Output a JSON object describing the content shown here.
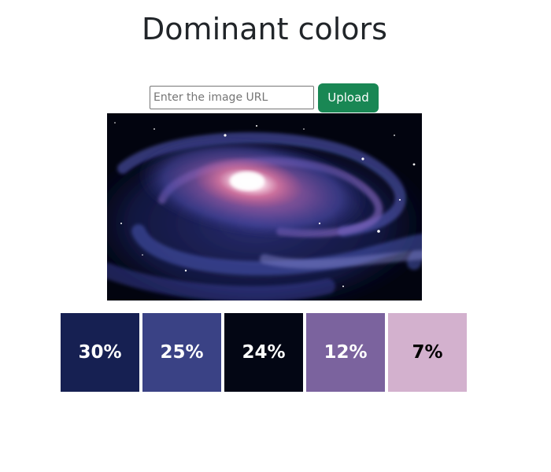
{
  "page": {
    "title": "Dominant colors"
  },
  "form": {
    "url_placeholder": "Enter the image URL",
    "url_value": "",
    "upload_label": "Upload",
    "upload_color": "#198754"
  },
  "image": {
    "subject": "spiral galaxy"
  },
  "swatches": [
    {
      "label": "30%",
      "color": "#162052",
      "text_color": "#ffffff"
    },
    {
      "label": "25%",
      "color": "#3a4285",
      "text_color": "#ffffff"
    },
    {
      "label": "24%",
      "color": "#030614",
      "text_color": "#ffffff"
    },
    {
      "label": "12%",
      "color": "#7b639e",
      "text_color": "#ffffff"
    },
    {
      "label": "7%",
      "color": "#d3b1ce",
      "text_color": "#000000"
    }
  ]
}
